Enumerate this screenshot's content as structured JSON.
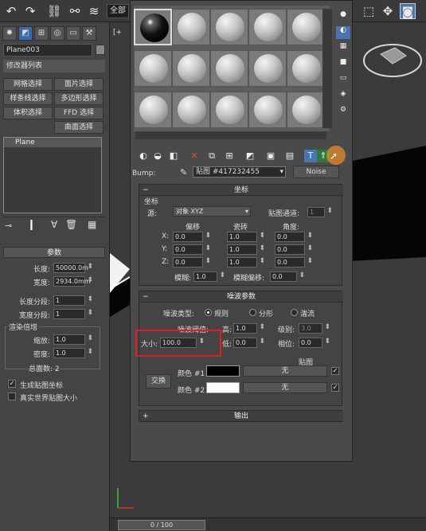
{
  "toolbar": {
    "undo_icon": "undo-icon",
    "redo_icon": "redo-icon",
    "selection_filter": "全部"
  },
  "command_panel": {
    "object_name": "Plane003",
    "modifier_list": "修改器列表",
    "modifier_buttons": [
      "网格选择",
      "面片选择",
      "样条线选择",
      "多边形选择",
      "体积选择",
      "FFD 选择",
      "曲面选择"
    ],
    "stack_item": "Plane",
    "params_title": "参数",
    "length_label": "长度:",
    "length_value": "50000.0m",
    "width_label": "宽度:",
    "width_value": "2934.0mm",
    "length_segs_label": "长度分段:",
    "length_segs_value": "1",
    "width_segs_label": "宽度分段:",
    "width_segs_value": "1",
    "render_mult_title": "渲染倍增",
    "scale_label": "缩放:",
    "scale_value": "1.0",
    "density_label": "密度:",
    "density_value": "1.0",
    "total_faces": "总面数: 2",
    "gen_map_coords": "生成贴图坐标",
    "real_world_map": "真实世界贴图大小"
  },
  "material_editor": {
    "bump_label": "Bump:",
    "map_name": "贴图 #417232455",
    "map_type": "Noise",
    "coords_title": "坐标",
    "coords_group": "坐标",
    "source_label": "源:",
    "source_value": "对象 XYZ",
    "map_channel_label": "贴图通道:",
    "map_channel_value": "1",
    "offset_label": "偏移",
    "tiling_label": "瓷砖",
    "angle_label": "角度:",
    "axis_x": "X:",
    "axis_y": "Y:",
    "axis_z": "Z:",
    "offset_values": [
      "0.0",
      "0.0",
      "0.0"
    ],
    "tiling_values": [
      "1.0",
      "1.0",
      "1.0"
    ],
    "angle_values": [
      "0.0",
      "0.0",
      "0.0"
    ],
    "blur_label": "模糊:",
    "blur_value": "1.0",
    "blur_offset_label": "模糊偏移:",
    "blur_offset_value": "0.0",
    "noise_title": "噪波参数",
    "noise_type_label": "噪波类型:",
    "noise_types": [
      "规则",
      "分形",
      "湍流"
    ],
    "noise_threshold_label": "噪波阈值:",
    "high_label": "高:",
    "high_value": "1.0",
    "levels_label": "级别:",
    "levels_value": "3.0",
    "size_label": "大小:",
    "size_value": "100.0",
    "low_label": "低:",
    "low_value": "0.0",
    "phase_label": "相位:",
    "phase_value": "0.0",
    "maps_label": "贴图",
    "swap_label": "交换",
    "color1_label": "颜色 #1",
    "color2_label": "颜色 #2",
    "color1": "#000000",
    "color2": "#ffffff",
    "map1_value": "无",
    "map2_value": "无",
    "output_title": "输出",
    "highlight_color": "#e02020"
  },
  "timeline": {
    "frame": "0 / 100"
  },
  "viewport": {
    "label": "[+"
  }
}
